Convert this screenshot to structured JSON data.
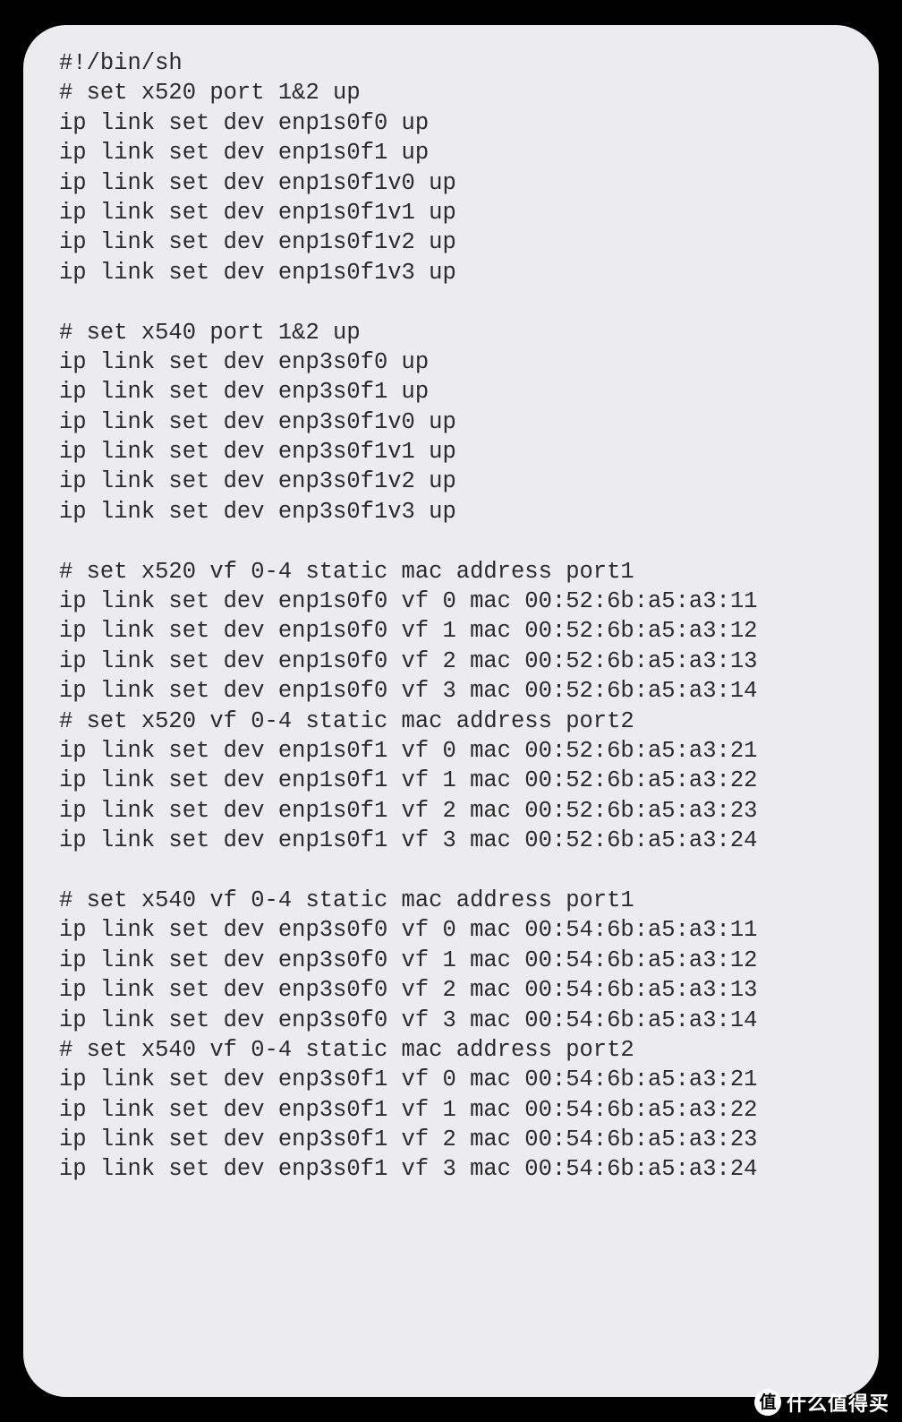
{
  "script": {
    "lines": [
      "#!/bin/sh",
      "# set x520 port 1&2 up",
      "ip link set dev enp1s0f0 up",
      "ip link set dev enp1s0f1 up",
      "ip link set dev enp1s0f1v0 up",
      "ip link set dev enp1s0f1v1 up",
      "ip link set dev enp1s0f1v2 up",
      "ip link set dev enp1s0f1v3 up",
      "",
      "# set x540 port 1&2 up",
      "ip link set dev enp3s0f0 up",
      "ip link set dev enp3s0f1 up",
      "ip link set dev enp3s0f1v0 up",
      "ip link set dev enp3s0f1v1 up",
      "ip link set dev enp3s0f1v2 up",
      "ip link set dev enp3s0f1v3 up",
      "",
      "# set x520 vf 0-4 static mac address port1",
      "ip link set dev enp1s0f0 vf 0 mac 00:52:6b:a5:a3:11",
      "ip link set dev enp1s0f0 vf 1 mac 00:52:6b:a5:a3:12",
      "ip link set dev enp1s0f0 vf 2 mac 00:52:6b:a5:a3:13",
      "ip link set dev enp1s0f0 vf 3 mac 00:52:6b:a5:a3:14",
      "# set x520 vf 0-4 static mac address port2",
      "ip link set dev enp1s0f1 vf 0 mac 00:52:6b:a5:a3:21",
      "ip link set dev enp1s0f1 vf 1 mac 00:52:6b:a5:a3:22",
      "ip link set dev enp1s0f1 vf 2 mac 00:52:6b:a5:a3:23",
      "ip link set dev enp1s0f1 vf 3 mac 00:52:6b:a5:a3:24",
      "",
      "# set x540 vf 0-4 static mac address port1",
      "ip link set dev enp3s0f0 vf 0 mac 00:54:6b:a5:a3:11",
      "ip link set dev enp3s0f0 vf 1 mac 00:54:6b:a5:a3:12",
      "ip link set dev enp3s0f0 vf 2 mac 00:54:6b:a5:a3:13",
      "ip link set dev enp3s0f0 vf 3 mac 00:54:6b:a5:a3:14",
      "# set x540 vf 0-4 static mac address port2",
      "ip link set dev enp3s0f1 vf 0 mac 00:54:6b:a5:a3:21",
      "ip link set dev enp3s0f1 vf 1 mac 00:54:6b:a5:a3:22",
      "ip link set dev enp3s0f1 vf 2 mac 00:54:6b:a5:a3:23",
      "ip link set dev enp3s0f1 vf 3 mac 00:54:6b:a5:a3:24"
    ]
  },
  "watermark": {
    "badge": "值",
    "text": "什么值得买"
  }
}
